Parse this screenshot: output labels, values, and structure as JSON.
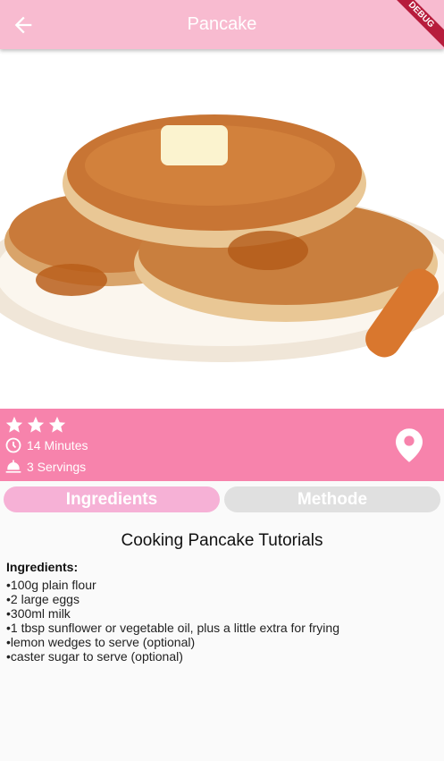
{
  "appbar": {
    "title": "Pancake",
    "back_icon": "arrow-left-icon",
    "debug_label": "DEBUG"
  },
  "hero": {
    "image": "pancake-stack-photo"
  },
  "info": {
    "rating_stars": 3,
    "time": "14 Minutes",
    "servings": "3 Servings",
    "colors": {
      "bar": "#f783ac"
    }
  },
  "tabs": [
    {
      "label": "Ingredients",
      "active": true
    },
    {
      "label": "Methode",
      "active": false
    }
  ],
  "content": {
    "title": "Cooking Pancake Tutorials",
    "label": "Ingredients:",
    "items": [
      "•100g plain flour",
      "•2 large eggs",
      "•300ml milk",
      "•1 tbsp sunflower or vegetable oil, plus a little extra for frying",
      "•lemon wedges to serve (optional)",
      "•caster sugar to serve (optional)"
    ]
  }
}
